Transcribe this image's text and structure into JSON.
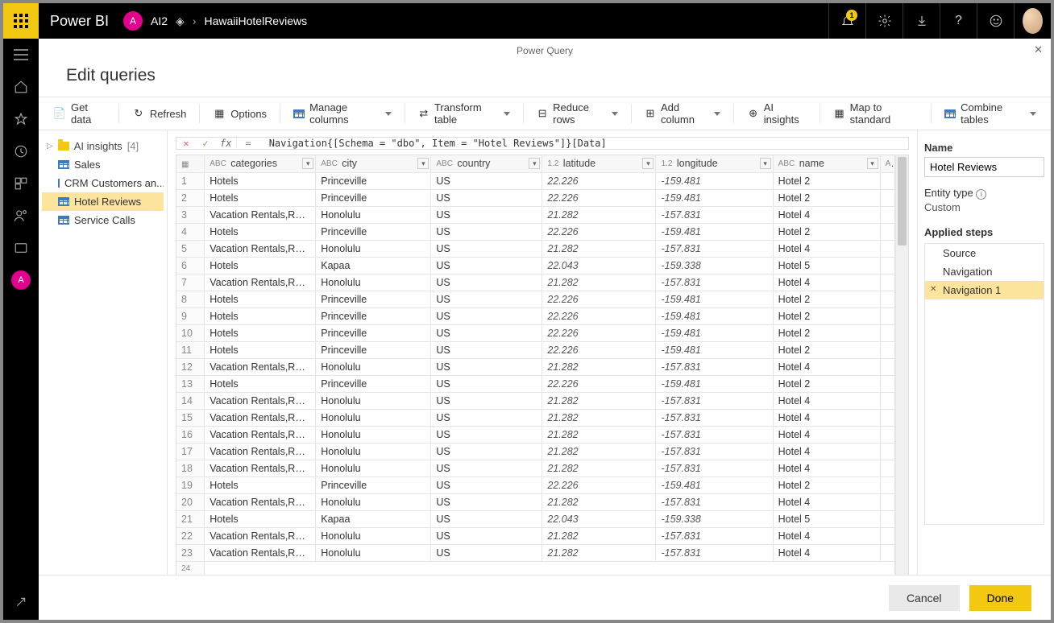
{
  "header": {
    "brand": "Power BI",
    "workspaceInitial": "A",
    "workspaceName": "AI2",
    "breadcrumbItem": "HawaiiHotelReviews",
    "notificationCount": "1"
  },
  "dialog": {
    "title": "Power Query",
    "subtitle": "Edit queries"
  },
  "toolbar": {
    "getData": "Get data",
    "refresh": "Refresh",
    "options": "Options",
    "manageColumns": "Manage columns",
    "transformTable": "Transform table",
    "reduceRows": "Reduce rows",
    "addColumn": "Add column",
    "aiInsights": "AI insights",
    "mapToStandard": "Map to standard",
    "combineTables": "Combine tables"
  },
  "queriesPane": {
    "groupLabel": "AI insights",
    "groupCount": "[4]",
    "items": [
      {
        "label": "Sales"
      },
      {
        "label": "CRM Customers an..."
      },
      {
        "label": "Hotel Reviews",
        "selected": true
      },
      {
        "label": "Service Calls"
      }
    ]
  },
  "formulaBar": {
    "eq": "=",
    "text": "Navigation{[Schema = \"dbo\", Item = \"Hotel Reviews\"]}[Data]"
  },
  "columns": [
    {
      "name": "categories",
      "type": "ABC"
    },
    {
      "name": "city",
      "type": "ABC"
    },
    {
      "name": "country",
      "type": "ABC"
    },
    {
      "name": "latitude",
      "type": "1.2"
    },
    {
      "name": "longitude",
      "type": "1.2"
    },
    {
      "name": "name",
      "type": "ABC"
    }
  ],
  "rows": [
    {
      "n": 1,
      "categories": "Hotels",
      "city": "Princeville",
      "country": "US",
      "lat": "22.226",
      "lon": "-159.481",
      "name": "Hotel 2"
    },
    {
      "n": 2,
      "categories": "Hotels",
      "city": "Princeville",
      "country": "US",
      "lat": "22.226",
      "lon": "-159.481",
      "name": "Hotel 2"
    },
    {
      "n": 3,
      "categories": "Vacation Rentals,Resorts &...",
      "city": "Honolulu",
      "country": "US",
      "lat": "21.282",
      "lon": "-157.831",
      "name": "Hotel 4"
    },
    {
      "n": 4,
      "categories": "Hotels",
      "city": "Princeville",
      "country": "US",
      "lat": "22.226",
      "lon": "-159.481",
      "name": "Hotel 2"
    },
    {
      "n": 5,
      "categories": "Vacation Rentals,Resorts &...",
      "city": "Honolulu",
      "country": "US",
      "lat": "21.282",
      "lon": "-157.831",
      "name": "Hotel 4"
    },
    {
      "n": 6,
      "categories": "Hotels",
      "city": "Kapaa",
      "country": "US",
      "lat": "22.043",
      "lon": "-159.338",
      "name": "Hotel 5"
    },
    {
      "n": 7,
      "categories": "Vacation Rentals,Resorts &...",
      "city": "Honolulu",
      "country": "US",
      "lat": "21.282",
      "lon": "-157.831",
      "name": "Hotel 4"
    },
    {
      "n": 8,
      "categories": "Hotels",
      "city": "Princeville",
      "country": "US",
      "lat": "22.226",
      "lon": "-159.481",
      "name": "Hotel 2"
    },
    {
      "n": 9,
      "categories": "Hotels",
      "city": "Princeville",
      "country": "US",
      "lat": "22.226",
      "lon": "-159.481",
      "name": "Hotel 2"
    },
    {
      "n": 10,
      "categories": "Hotels",
      "city": "Princeville",
      "country": "US",
      "lat": "22.226",
      "lon": "-159.481",
      "name": "Hotel 2"
    },
    {
      "n": 11,
      "categories": "Hotels",
      "city": "Princeville",
      "country": "US",
      "lat": "22.226",
      "lon": "-159.481",
      "name": "Hotel 2"
    },
    {
      "n": 12,
      "categories": "Vacation Rentals,Resorts &...",
      "city": "Honolulu",
      "country": "US",
      "lat": "21.282",
      "lon": "-157.831",
      "name": "Hotel 4"
    },
    {
      "n": 13,
      "categories": "Hotels",
      "city": "Princeville",
      "country": "US",
      "lat": "22.226",
      "lon": "-159.481",
      "name": "Hotel 2"
    },
    {
      "n": 14,
      "categories": "Vacation Rentals,Resorts &...",
      "city": "Honolulu",
      "country": "US",
      "lat": "21.282",
      "lon": "-157.831",
      "name": "Hotel 4"
    },
    {
      "n": 15,
      "categories": "Vacation Rentals,Resorts &...",
      "city": "Honolulu",
      "country": "US",
      "lat": "21.282",
      "lon": "-157.831",
      "name": "Hotel 4"
    },
    {
      "n": 16,
      "categories": "Vacation Rentals,Resorts &...",
      "city": "Honolulu",
      "country": "US",
      "lat": "21.282",
      "lon": "-157.831",
      "name": "Hotel 4"
    },
    {
      "n": 17,
      "categories": "Vacation Rentals,Resorts &...",
      "city": "Honolulu",
      "country": "US",
      "lat": "21.282",
      "lon": "-157.831",
      "name": "Hotel 4"
    },
    {
      "n": 18,
      "categories": "Vacation Rentals,Resorts &...",
      "city": "Honolulu",
      "country": "US",
      "lat": "21.282",
      "lon": "-157.831",
      "name": "Hotel 4"
    },
    {
      "n": 19,
      "categories": "Hotels",
      "city": "Princeville",
      "country": "US",
      "lat": "22.226",
      "lon": "-159.481",
      "name": "Hotel 2"
    },
    {
      "n": 20,
      "categories": "Vacation Rentals,Resorts &...",
      "city": "Honolulu",
      "country": "US",
      "lat": "21.282",
      "lon": "-157.831",
      "name": "Hotel 4"
    },
    {
      "n": 21,
      "categories": "Hotels",
      "city": "Kapaa",
      "country": "US",
      "lat": "22.043",
      "lon": "-159.338",
      "name": "Hotel 5"
    },
    {
      "n": 22,
      "categories": "Vacation Rentals,Resorts &...",
      "city": "Honolulu",
      "country": "US",
      "lat": "21.282",
      "lon": "-157.831",
      "name": "Hotel 4"
    },
    {
      "n": 23,
      "categories": "Vacation Rentals,Resorts &...",
      "city": "Honolulu",
      "country": "US",
      "lat": "21.282",
      "lon": "-157.831",
      "name": "Hotel 4"
    }
  ],
  "rightPane": {
    "nameLabel": "Name",
    "nameValue": "Hotel Reviews",
    "entityTypeLabel": "Entity type",
    "entityTypeValue": "Custom",
    "appliedStepsLabel": "Applied steps",
    "steps": [
      {
        "label": "Source"
      },
      {
        "label": "Navigation"
      },
      {
        "label": "Navigation 1",
        "selected": true
      }
    ]
  },
  "footer": {
    "cancel": "Cancel",
    "done": "Done"
  }
}
